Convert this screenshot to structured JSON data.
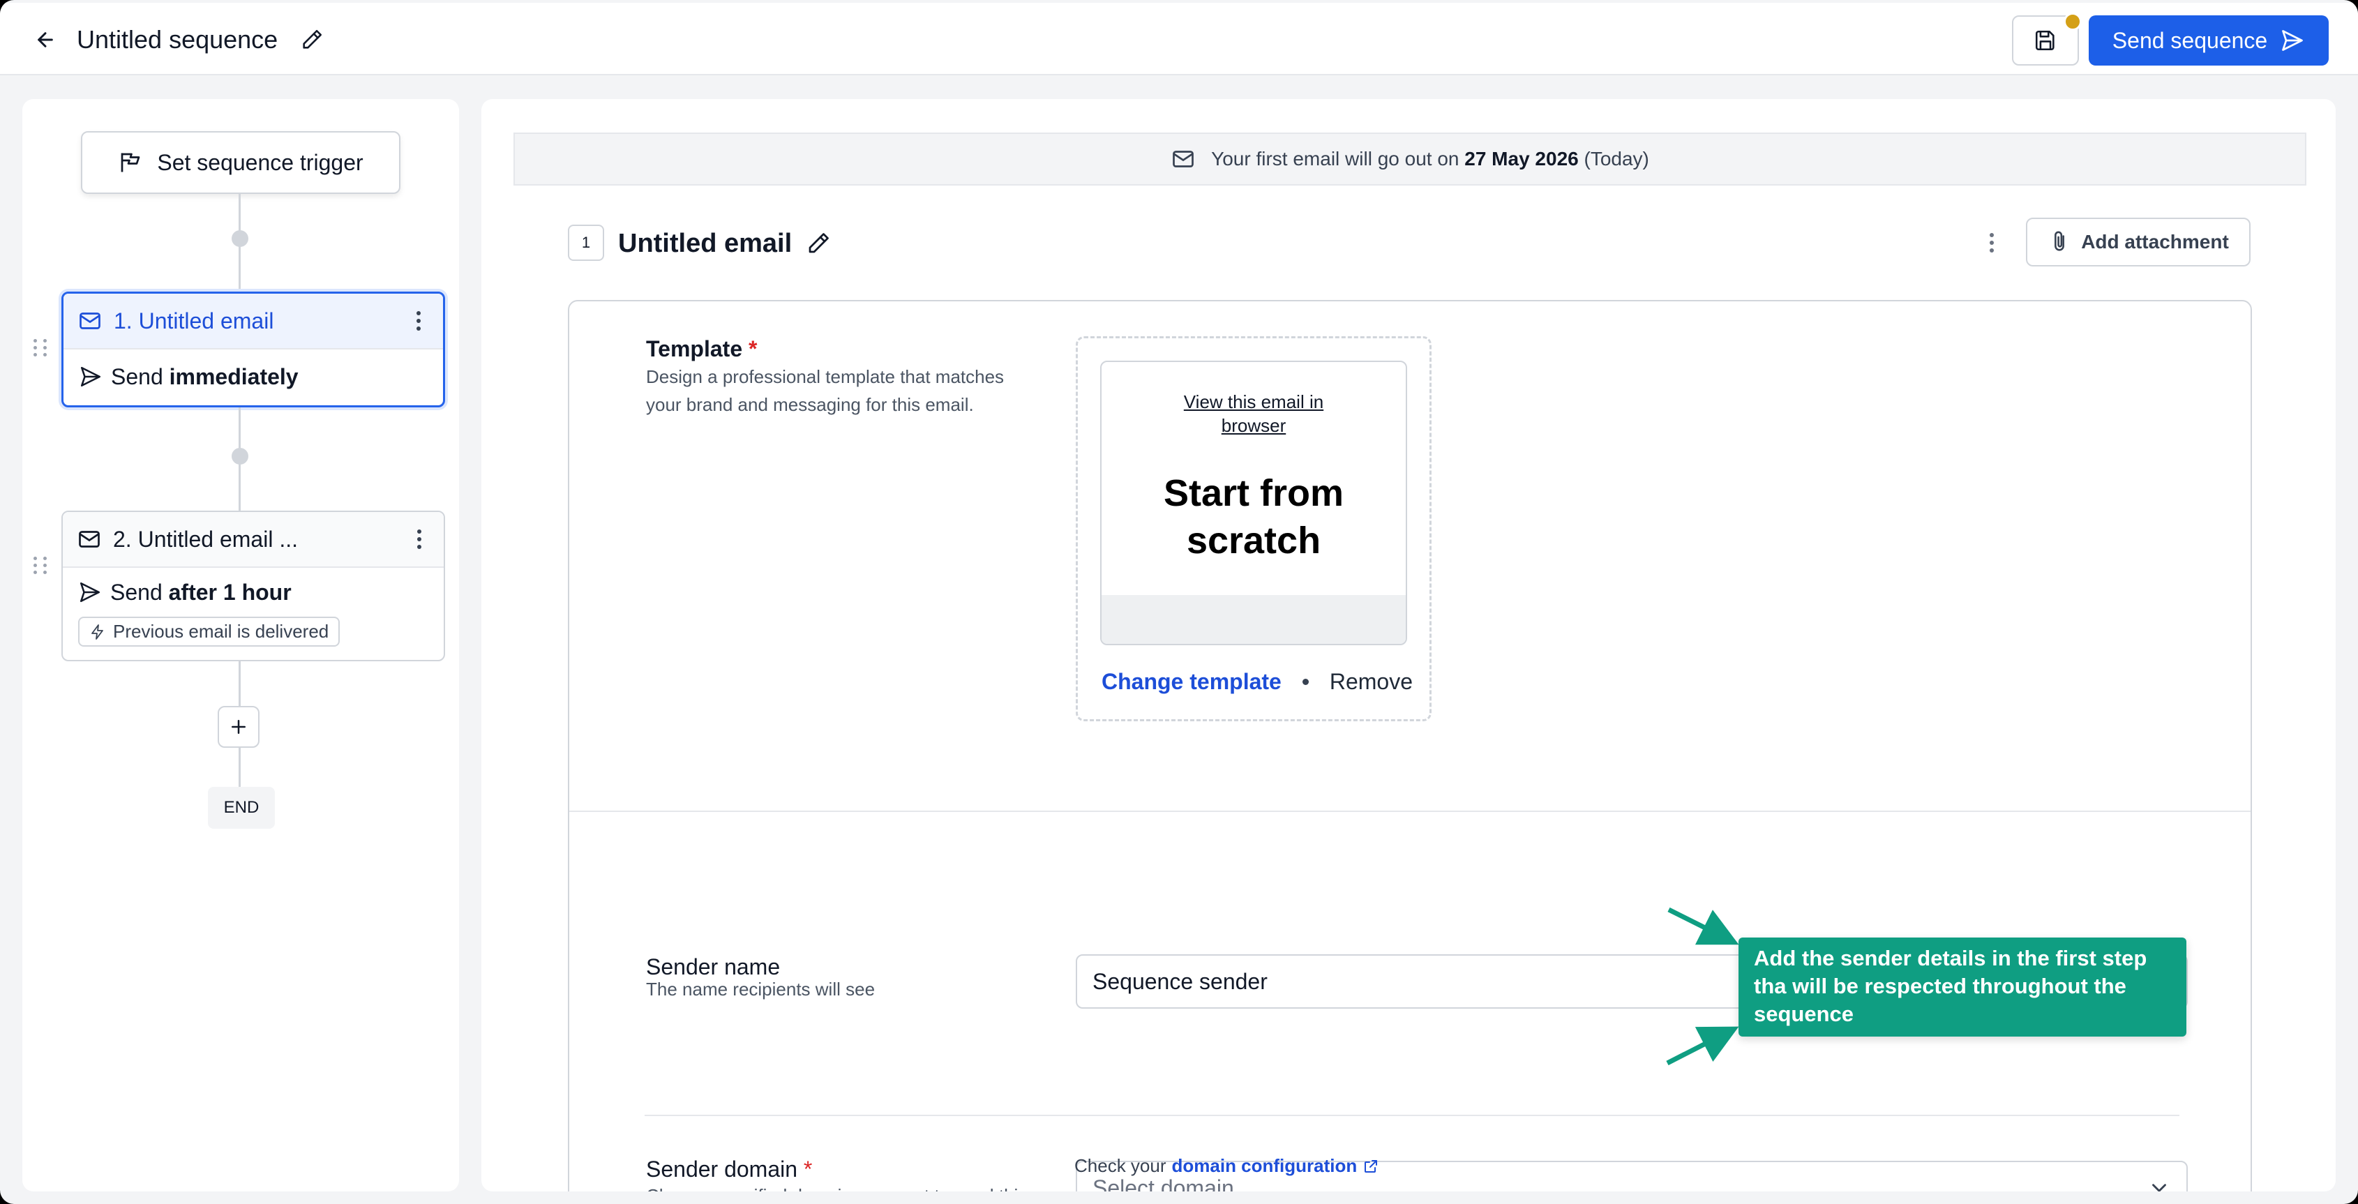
{
  "header": {
    "title": "Untitled sequence",
    "send_label": "Send sequence"
  },
  "flow": {
    "trigger_label": "Set sequence trigger",
    "steps": [
      {
        "title": "1. Untitled email",
        "send_prefix": "Send ",
        "send_value": "immediately"
      },
      {
        "title": "2. Untitled email ...",
        "send_prefix": "Send ",
        "send_value": "after 1 hour",
        "condition": "Previous email is delivered"
      }
    ],
    "end_label": "END"
  },
  "info_bar": {
    "prefix": "Your first email will go out on ",
    "date": "27 May 2026",
    "suffix": " (Today)"
  },
  "email": {
    "number": "1",
    "title": "Untitled email",
    "attach_label": "Add attachment"
  },
  "template": {
    "label": "Template",
    "required_mark": "*",
    "description": "Design a professional template that matches your brand and messaging for this email.",
    "preview_link": "View this email in browser",
    "preview_heading": "Start from scratch",
    "change_label": "Change template",
    "remove_label": "Remove"
  },
  "sender_name": {
    "label": "Sender name",
    "description": "The name recipients will see",
    "value": "Sequence sender"
  },
  "sender_domain": {
    "label": "Sender domain",
    "required_mark": "*",
    "description": "Choose a verified domain you want to send this email from",
    "placeholder": "Select domain",
    "help_prefix": "Check your ",
    "help_link": "domain configuration"
  },
  "callout": {
    "text": "Add the sender details in the first step tha will be respected throughout the sequence"
  },
  "colors": {
    "primary": "#1d5fe8",
    "callout": "#0f9e82",
    "unsaved_dot": "#d4a017",
    "required": "#dc2626"
  }
}
